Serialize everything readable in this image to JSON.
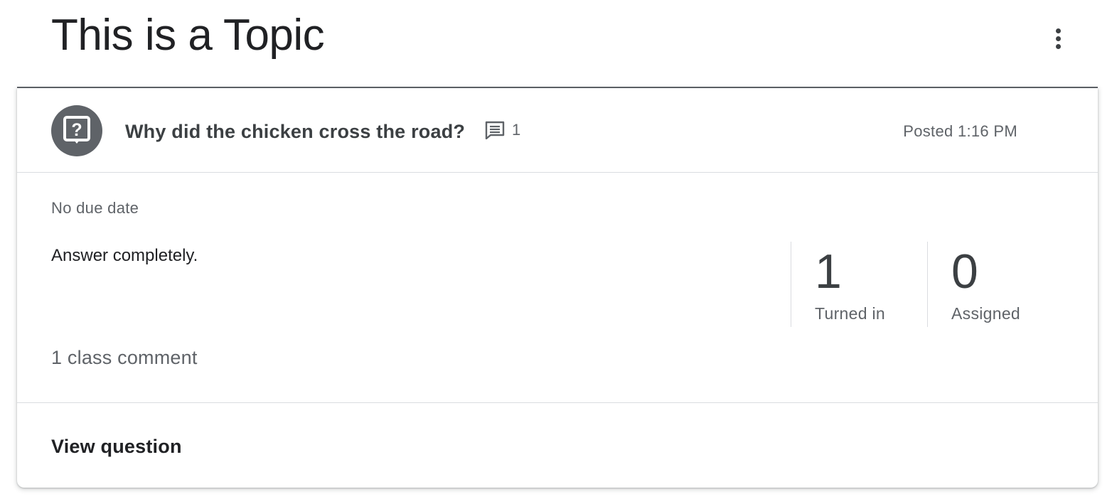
{
  "topic": {
    "title": "This is a Topic"
  },
  "question": {
    "title": "Why did the chicken cross the road?",
    "comment_count": "1",
    "posted": "Posted 1:16 PM",
    "due": "No due date",
    "description": "Answer completely.",
    "class_comment": "1 class comment",
    "view_label": "View question",
    "stats": [
      {
        "value": "1",
        "label": "Turned in"
      },
      {
        "value": "0",
        "label": "Assigned"
      }
    ]
  },
  "icons": {
    "question": "question-icon",
    "comment": "comment-icon",
    "more": "more-vert-icon"
  }
}
